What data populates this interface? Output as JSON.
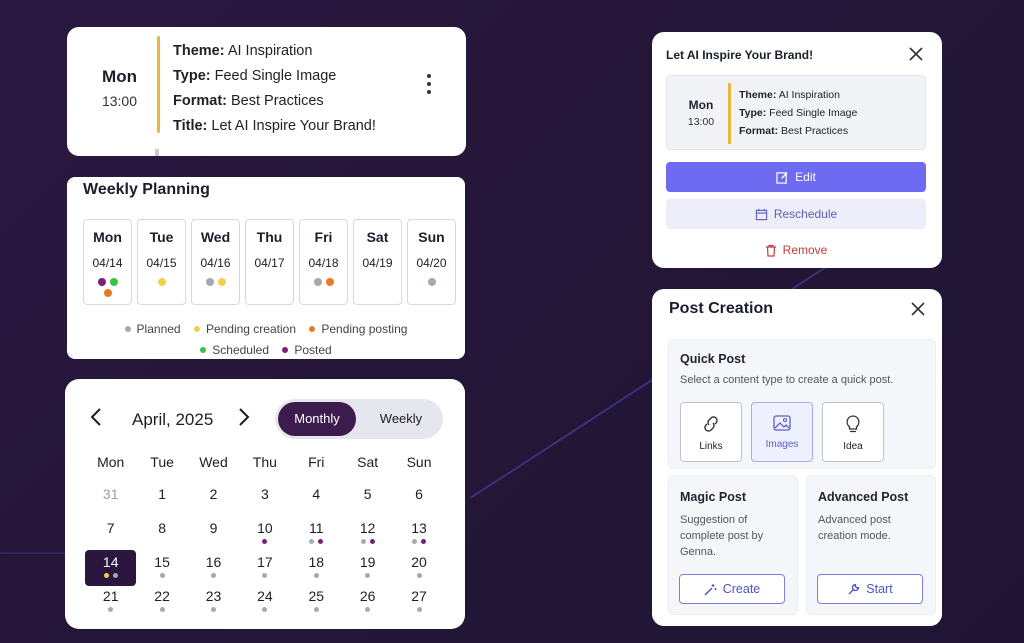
{
  "event_card": {
    "day": "Mon",
    "time": "13:00",
    "theme_label": "Theme:",
    "theme_value": "AI Inspiration",
    "type_label": "Type:",
    "type_value": "Feed Single Image",
    "format_label": "Format:",
    "format_value": "Best Practices",
    "title_label": "Title:",
    "title_value": "Let AI Inspire Your Brand!"
  },
  "weekly": {
    "title": "Weekly Planning",
    "days": [
      {
        "name": "Mon",
        "date": "04/14",
        "dots": [
          "#7b1f78",
          "#3cc242",
          "#ea7a22"
        ]
      },
      {
        "name": "Tue",
        "date": "04/15",
        "dots": [
          "#f4cf4e"
        ]
      },
      {
        "name": "Wed",
        "date": "04/16",
        "dots": [
          "#a5a9b3",
          "#f4cf4e"
        ]
      },
      {
        "name": "Thu",
        "date": "04/17",
        "dots": []
      },
      {
        "name": "Fri",
        "date": "04/18",
        "dots": [
          "#a5a9b3",
          "#ea7a22"
        ]
      },
      {
        "name": "Sat",
        "date": "04/19",
        "dots": []
      },
      {
        "name": "Sun",
        "date": "04/20",
        "dots": [
          "#a5a9b3"
        ]
      }
    ],
    "legend": {
      "planned": "Planned",
      "pending_creation": "Pending creation",
      "pending_posting": "Pending posting",
      "scheduled": "Scheduled",
      "posted": "Posted"
    },
    "colors": {
      "planned": "#a5a9b3",
      "pending_creation": "#f4cf4e",
      "pending_posting": "#ea7a22",
      "scheduled": "#3cc242",
      "posted": "#7b1f78"
    }
  },
  "calendar": {
    "month": "April, 2025",
    "view_monthly": "Monthly",
    "view_weekly": "Weekly",
    "weekdays": [
      "Mon",
      "Tue",
      "Wed",
      "Thu",
      "Fri",
      "Sat",
      "Sun"
    ],
    "days": [
      {
        "n": "31",
        "muted": true,
        "dots": []
      },
      {
        "n": "1",
        "dots": []
      },
      {
        "n": "2",
        "dots": []
      },
      {
        "n": "3",
        "dots": []
      },
      {
        "n": "4",
        "dots": []
      },
      {
        "n": "5",
        "dots": []
      },
      {
        "n": "6",
        "dots": []
      },
      {
        "n": "7",
        "dots": []
      },
      {
        "n": "8",
        "dots": []
      },
      {
        "n": "9",
        "dots": []
      },
      {
        "n": "10",
        "dots": [
          "#7b1f78"
        ]
      },
      {
        "n": "11",
        "dots": [
          "#a5a9b3",
          "#7b1f78"
        ]
      },
      {
        "n": "12",
        "dots": [
          "#a5a9b3",
          "#7b1f78"
        ]
      },
      {
        "n": "13",
        "dots": [
          "#a5a9b3",
          "#7b1f78"
        ]
      },
      {
        "n": "14",
        "today": true,
        "dots": [
          "#f4cf4e",
          "#a5a9b3"
        ]
      },
      {
        "n": "15",
        "dots": [
          "#a5a9b3"
        ]
      },
      {
        "n": "16",
        "dots": [
          "#a5a9b3"
        ]
      },
      {
        "n": "17",
        "dots": [
          "#a5a9b3"
        ]
      },
      {
        "n": "18",
        "dots": [
          "#a5a9b3"
        ]
      },
      {
        "n": "19",
        "dots": [
          "#a5a9b3"
        ]
      },
      {
        "n": "20",
        "dots": [
          "#a5a9b3"
        ]
      },
      {
        "n": "21",
        "dots": [
          "#a5a9b3"
        ]
      },
      {
        "n": "22",
        "dots": [
          "#a5a9b3"
        ]
      },
      {
        "n": "23",
        "dots": [
          "#a5a9b3"
        ]
      },
      {
        "n": "24",
        "dots": [
          "#a5a9b3"
        ]
      },
      {
        "n": "25",
        "dots": [
          "#a5a9b3"
        ]
      },
      {
        "n": "26",
        "dots": [
          "#a5a9b3"
        ]
      },
      {
        "n": "27",
        "dots": [
          "#a5a9b3"
        ]
      }
    ]
  },
  "dialog": {
    "title": "Let AI Inspire Your Brand!",
    "day": "Mon",
    "time": "13:00",
    "theme_label": "Theme:",
    "theme_value": "AI Inspiration",
    "type_label": "Type:",
    "type_value": "Feed Single Image",
    "format_label": "Format:",
    "format_value": "Best Practices",
    "edit": "Edit",
    "reschedule": "Reschedule",
    "remove": "Remove"
  },
  "post_creation": {
    "title": "Post Creation",
    "quick_title": "Quick Post",
    "quick_desc": "Select a content type to create a quick post.",
    "links": "Links",
    "images": "Images",
    "idea": "Idea",
    "magic_title": "Magic Post",
    "magic_desc": "Suggestion of complete post by Genna.",
    "magic_btn": "Create",
    "adv_title": "Advanced Post",
    "adv_desc": "Advanced post creation mode.",
    "adv_btn": "Start"
  }
}
